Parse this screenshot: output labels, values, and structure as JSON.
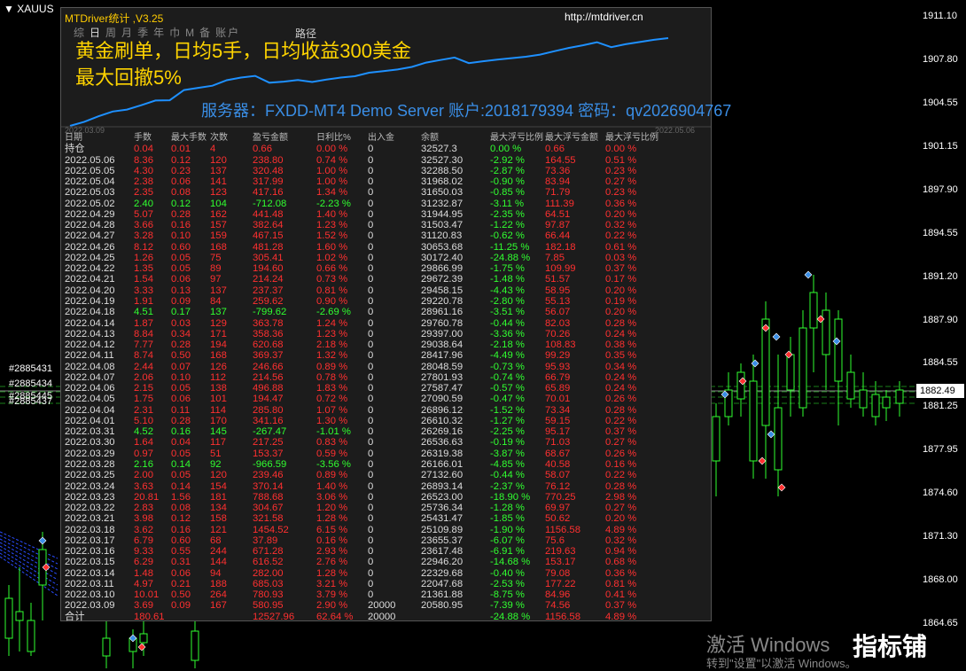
{
  "symbol": "XAUUS",
  "panel": {
    "title": "MTDriver统计 ,V3.25",
    "url": "http://mtdriver.cn",
    "tabs": [
      "综",
      "日",
      "周",
      "月",
      "季",
      "年",
      "巾",
      "M",
      "备",
      "账户"
    ],
    "active_tab": "日",
    "path_label": "路径",
    "overlay_line1": "黄金刷单，日均5手，日均收益300美金",
    "overlay_line2": "最大回撤5%",
    "server_info": "服务器：FXDD-MT4 Demo Server  账户:2018179394   密码：qv2026904767",
    "start_date": "2022.03.09",
    "end_date": "2022.05.06",
    "headers": [
      "日期",
      "手数",
      "最大手数",
      "次数",
      "盈亏金额",
      "日利比%",
      "出入金",
      "余额",
      "最大浮亏比例",
      "最大浮亏金额",
      "最大浮亏比例"
    ],
    "rows": [
      [
        "持仓",
        "0.04",
        "0.01",
        "4",
        "0.66",
        "0.00 %",
        "0",
        "32527.3",
        "0.00 %",
        "0.66",
        "0.00 %"
      ],
      [
        "2022.05.06",
        "8.36",
        "0.12",
        "120",
        "238.80",
        "0.74 %",
        "0",
        "32527.30",
        "-2.92 %",
        "164.55",
        "0.51 %"
      ],
      [
        "2022.05.05",
        "4.30",
        "0.23",
        "137",
        "320.48",
        "1.00 %",
        "0",
        "32288.50",
        "-2.87 %",
        "73.36",
        "0.23 %"
      ],
      [
        "2022.05.04",
        "2.38",
        "0.06",
        "141",
        "317.99",
        "1.00 %",
        "0",
        "31968.02",
        "-0.90 %",
        "83.94",
        "0.27 %"
      ],
      [
        "2022.05.03",
        "2.35",
        "0.08",
        "123",
        "417.16",
        "1.34 %",
        "0",
        "31650.03",
        "-0.85 %",
        "71.79",
        "0.23 %"
      ],
      [
        "2022.05.02",
        "2.40",
        "0.12",
        "104",
        "-712.08",
        "-2.23 %",
        "0",
        "31232.87",
        "-3.11 %",
        "111.39",
        "0.36 %"
      ],
      [
        "2022.04.29",
        "5.07",
        "0.28",
        "162",
        "441.48",
        "1.40 %",
        "0",
        "31944.95",
        "-2.35 %",
        "64.51",
        "0.20 %"
      ],
      [
        "2022.04.28",
        "3.66",
        "0.16",
        "157",
        "382.64",
        "1.23 %",
        "0",
        "31503.47",
        "-1.22 %",
        "97.87",
        "0.32 %"
      ],
      [
        "2022.04.27",
        "3.28",
        "0.10",
        "159",
        "467.15",
        "1.52 %",
        "0",
        "31120.83",
        "-0.62 %",
        "66.44",
        "0.22 %"
      ],
      [
        "2022.04.26",
        "8.12",
        "0.60",
        "168",
        "481.28",
        "1.60 %",
        "0",
        "30653.68",
        "-11.25 %",
        "182.18",
        "0.61 %"
      ],
      [
        "2022.04.25",
        "1.26",
        "0.05",
        "75",
        "305.41",
        "1.02 %",
        "0",
        "30172.40",
        "-24.88 %",
        "7.85",
        "0.03 %"
      ],
      [
        "2022.04.22",
        "1.35",
        "0.05",
        "89",
        "194.60",
        "0.66 %",
        "0",
        "29866.99",
        "-1.75 %",
        "109.99",
        "0.37 %"
      ],
      [
        "2022.04.21",
        "1.54",
        "0.06",
        "97",
        "214.24",
        "0.73 %",
        "0",
        "29672.39",
        "-1.48 %",
        "51.57",
        "0.17 %"
      ],
      [
        "2022.04.20",
        "3.33",
        "0.13",
        "137",
        "237.37",
        "0.81 %",
        "0",
        "29458.15",
        "-4.43 %",
        "58.95",
        "0.20 %"
      ],
      [
        "2022.04.19",
        "1.91",
        "0.09",
        "84",
        "259.62",
        "0.90 %",
        "0",
        "29220.78",
        "-2.80 %",
        "55.13",
        "0.19 %"
      ],
      [
        "2022.04.18",
        "4.51",
        "0.17",
        "137",
        "-799.62",
        "-2.69 %",
        "0",
        "28961.16",
        "-3.51 %",
        "56.07",
        "0.20 %"
      ],
      [
        "2022.04.14",
        "1.87",
        "0.03",
        "129",
        "363.78",
        "1.24 %",
        "0",
        "29760.78",
        "-0.44 %",
        "82.03",
        "0.28 %"
      ],
      [
        "2022.04.13",
        "8.84",
        "0.34",
        "171",
        "358.36",
        "1.23 %",
        "0",
        "29397.00",
        "-3.36 %",
        "70.26",
        "0.24 %"
      ],
      [
        "2022.04.12",
        "7.77",
        "0.28",
        "194",
        "620.68",
        "2.18 %",
        "0",
        "29038.64",
        "-2.18 %",
        "108.83",
        "0.38 %"
      ],
      [
        "2022.04.11",
        "8.74",
        "0.50",
        "168",
        "369.37",
        "1.32 %",
        "0",
        "28417.96",
        "-4.49 %",
        "99.29",
        "0.35 %"
      ],
      [
        "2022.04.08",
        "2.44",
        "0.07",
        "126",
        "246.66",
        "0.89 %",
        "0",
        "28048.59",
        "-0.73 %",
        "95.93",
        "0.34 %"
      ],
      [
        "2022.04.07",
        "2.06",
        "0.10",
        "112",
        "214.56",
        "0.78 %",
        "0",
        "27801.93",
        "-0.74 %",
        "66.79",
        "0.24 %"
      ],
      [
        "2022.04.06",
        "2.15",
        "0.05",
        "138",
        "496.88",
        "1.83 %",
        "0",
        "27587.47",
        "-0.57 %",
        "65.89",
        "0.24 %"
      ],
      [
        "2022.04.05",
        "1.75",
        "0.06",
        "101",
        "194.47",
        "0.72 %",
        "0",
        "27090.59",
        "-0.47 %",
        "70.01",
        "0.26 %"
      ],
      [
        "2022.04.04",
        "2.31",
        "0.11",
        "114",
        "285.80",
        "1.07 %",
        "0",
        "26896.12",
        "-1.52 %",
        "73.34",
        "0.28 %"
      ],
      [
        "2022.04.01",
        "5.10",
        "0.28",
        "170",
        "341.16",
        "1.30 %",
        "0",
        "26610.32",
        "-1.27 %",
        "59.15",
        "0.22 %"
      ],
      [
        "2022.03.31",
        "4.52",
        "0.16",
        "145",
        "-267.47",
        "-1.01 %",
        "0",
        "26269.16",
        "-2.25 %",
        "95.17",
        "0.37 %"
      ],
      [
        "2022.03.30",
        "1.64",
        "0.04",
        "117",
        "217.25",
        "0.83 %",
        "0",
        "26536.63",
        "-0.19 %",
        "71.03",
        "0.27 %"
      ],
      [
        "2022.03.29",
        "0.97",
        "0.05",
        "51",
        "153.37",
        "0.59 %",
        "0",
        "26319.38",
        "-3.87 %",
        "68.67",
        "0.26 %"
      ],
      [
        "2022.03.28",
        "2.16",
        "0.14",
        "92",
        "-966.59",
        "-3.56 %",
        "0",
        "26166.01",
        "-4.85 %",
        "40.58",
        "0.16 %"
      ],
      [
        "2022.03.25",
        "2.00",
        "0.05",
        "120",
        "239.46",
        "0.89 %",
        "0",
        "27132.60",
        "-0.44 %",
        "58.07",
        "0.22 %"
      ],
      [
        "2022.03.24",
        "3.63",
        "0.14",
        "154",
        "370.14",
        "1.40 %",
        "0",
        "26893.14",
        "-2.37 %",
        "76.12",
        "0.28 %"
      ],
      [
        "2022.03.23",
        "20.81",
        "1.56",
        "181",
        "788.68",
        "3.06 %",
        "0",
        "26523.00",
        "-18.90 %",
        "770.25",
        "2.98 %"
      ],
      [
        "2022.03.22",
        "2.83",
        "0.08",
        "134",
        "304.67",
        "1.20 %",
        "0",
        "25736.34",
        "-1.28 %",
        "69.97",
        "0.27 %"
      ],
      [
        "2022.03.21",
        "3.98",
        "0.12",
        "158",
        "321.58",
        "1.28 %",
        "0",
        "25431.47",
        "-1.85 %",
        "50.62",
        "0.20 %"
      ],
      [
        "2022.03.18",
        "3.62",
        "0.16",
        "121",
        "1454.52",
        "6.15 %",
        "0",
        "25109.89",
        "-1.90 %",
        "1156.58",
        "4.89 %"
      ],
      [
        "2022.03.17",
        "6.79",
        "0.60",
        "68",
        "37.89",
        "0.16 %",
        "0",
        "23655.37",
        "-6.07 %",
        "75.6",
        "0.32 %"
      ],
      [
        "2022.03.16",
        "9.33",
        "0.55",
        "244",
        "671.28",
        "2.93 %",
        "0",
        "23617.48",
        "-6.91 %",
        "219.63",
        "0.94 %"
      ],
      [
        "2022.03.15",
        "6.29",
        "0.31",
        "144",
        "616.52",
        "2.76 %",
        "0",
        "22946.20",
        "-14.68 %",
        "153.17",
        "0.68 %"
      ],
      [
        "2022.03.14",
        "1.48",
        "0.06",
        "94",
        "282.00",
        "1.28 %",
        "0",
        "22329.68",
        "-0.40 %",
        "79.08",
        "0.36 %"
      ],
      [
        "2022.03.11",
        "4.97",
        "0.21",
        "188",
        "685.03",
        "3.21 %",
        "0",
        "22047.68",
        "-2.53 %",
        "177.22",
        "0.81 %"
      ],
      [
        "2022.03.10",
        "10.01",
        "0.50",
        "264",
        "780.93",
        "3.79 %",
        "0",
        "21361.88",
        "-8.75 %",
        "84.96",
        "0.41 %"
      ],
      [
        "2022.03.09",
        "3.69",
        "0.09",
        "167",
        "580.95",
        "2.90 %",
        "20000",
        "20580.95",
        "-7.39 %",
        "74.56",
        "0.37 %"
      ],
      [
        "合计",
        "180.61",
        "",
        "",
        "12527.96",
        "62.64 %",
        "20000",
        "",
        "-24.88 %",
        "1156.58",
        "4.89 %"
      ]
    ]
  },
  "price_axis": [
    "1911.10",
    "1907.80",
    "1904.55",
    "1901.15",
    "1897.90",
    "1894.55",
    "1891.20",
    "1887.90",
    "1884.55",
    "1881.25",
    "1877.95",
    "1874.60",
    "1871.30",
    "1868.00",
    "1864.65"
  ],
  "current_price": "1882.49",
  "order_labels": [
    "#2885431",
    "#2885434",
    "#2885445",
    "#2885437"
  ],
  "watermark_line1": "激活 Windows",
  "watermark_line2": "转到\"设置\"以激活 Windows。",
  "brand": "指标铺",
  "colors": {
    "profit": "#ff3030",
    "loss": "#30ff30",
    "curve": "#1e90ff",
    "overlay": "#ffd400",
    "server": "#3a8ee6"
  }
}
